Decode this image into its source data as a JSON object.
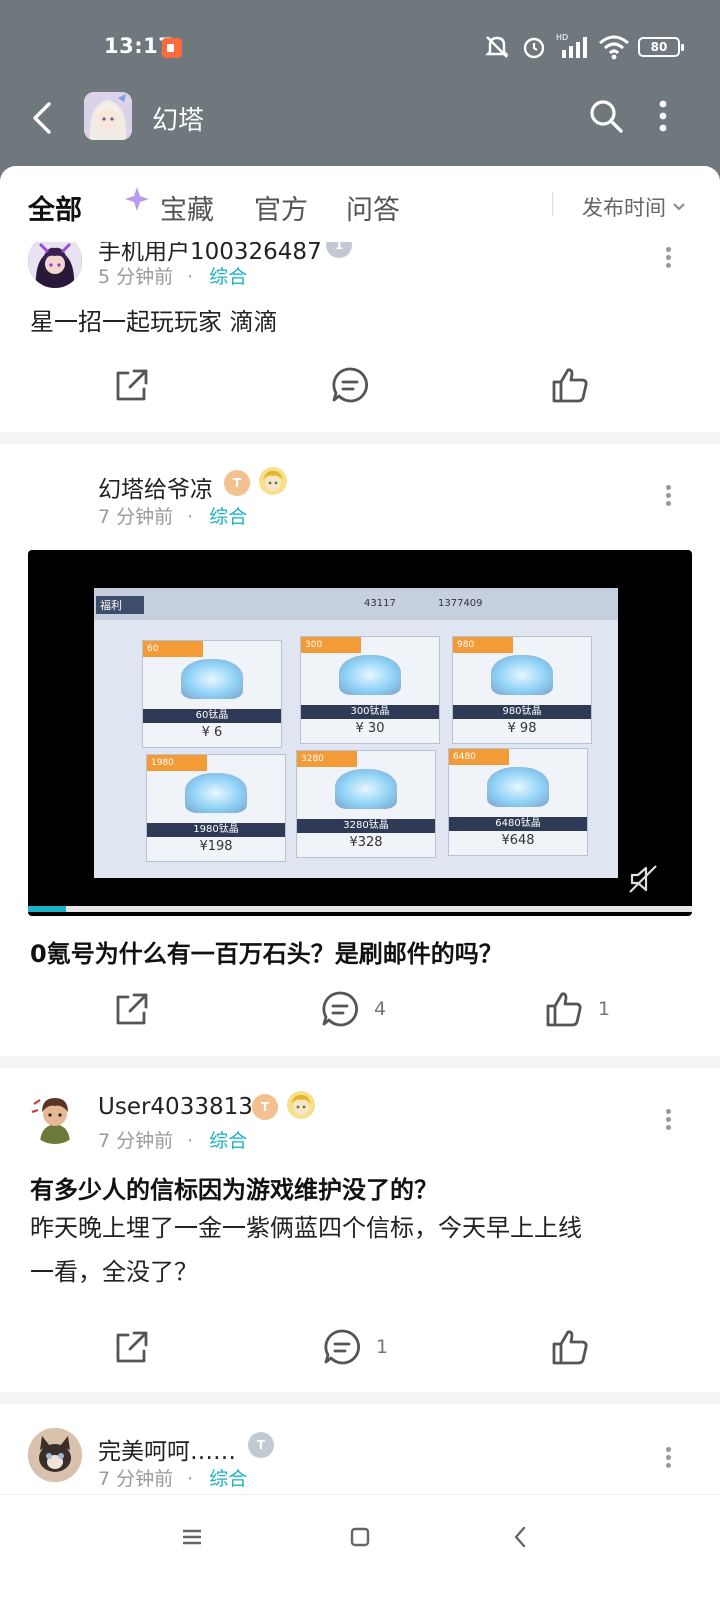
{
  "status_bar": {
    "time": "13:17",
    "battery": "80"
  },
  "app_bar": {
    "title": "幻塔"
  },
  "tabs": [
    {
      "label": "全部",
      "active": true
    },
    {
      "label": "宝藏",
      "active": false
    },
    {
      "label": "官方",
      "active": false
    },
    {
      "label": "问答",
      "active": false
    }
  ],
  "sort_label": "发布时间",
  "posts": [
    {
      "username": "手机用户100326487",
      "time": "5 分钟前",
      "tag": "综合",
      "text": "星一招一起玩玩家 滴滴",
      "comments": "",
      "likes": ""
    },
    {
      "username": "幻塔给爷凉",
      "time": "7 分钟前",
      "tag": "综合",
      "title": "0氪号为什么有一百万石头？是刷邮件的吗？",
      "comments": "4",
      "likes": "1",
      "video": {
        "screen_label": "福利",
        "currency_1": "43117",
        "currency_2": "1377409",
        "items": [
          {
            "name": "60钛晶",
            "price": "¥ 6",
            "hot": "60"
          },
          {
            "name": "300钛晶",
            "price": "¥ 30",
            "hot": "300"
          },
          {
            "name": "980钛晶",
            "price": "¥ 98",
            "hot": "980"
          },
          {
            "name": "1980钛晶",
            "price": "¥198",
            "hot": "1980"
          },
          {
            "name": "3280钛晶",
            "price": "¥328",
            "hot": "3280"
          },
          {
            "name": "6480钛晶",
            "price": "¥648",
            "hot": "6480"
          }
        ]
      }
    },
    {
      "username": "User4033813",
      "time": "7 分钟前",
      "tag": "综合",
      "title": "有多少人的信标因为游戏维护没了的？",
      "text_line1": "昨天晚上埋了一金一紫俩蓝四个信标，今天早上上线",
      "text_line2": "一看，全没了？",
      "comments": "1",
      "likes": ""
    },
    {
      "username": "完美呵呵……",
      "time": "7 分钟前",
      "tag": "综合"
    }
  ],
  "colors": {
    "header_gray": "#6f787c",
    "accent_teal": "#1bb3c7"
  }
}
